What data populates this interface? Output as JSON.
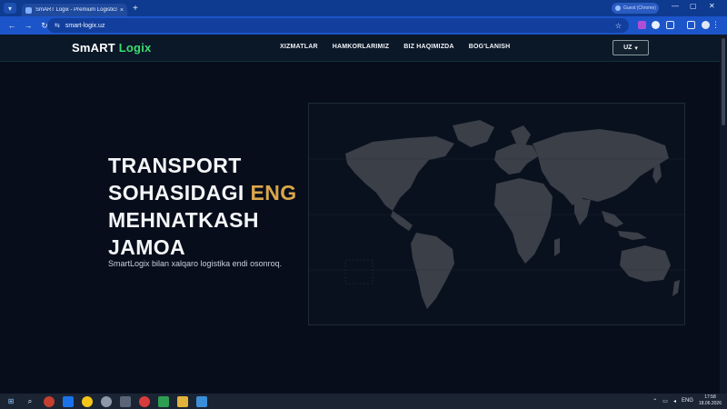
{
  "browser": {
    "tab_title": "SmART Logix - Premium Logistics",
    "tab_close": "×",
    "new_tab": "+",
    "profile": "Guest (Chrome)",
    "url": "smart-logix.uz",
    "back": "←",
    "forward": "→",
    "reload": "↻",
    "site_info": "⇆",
    "star": "☆",
    "menu": "⋮",
    "minimize": "—",
    "maximize": "▢",
    "close": "✕"
  },
  "header": {
    "logo_part1": "SmART",
    "logo_part2": "Logix",
    "nav": [
      "XIZMATLAR",
      "HAMKORLARIMIZ",
      "BIZ HAQIMIZDA",
      "BOG'LANISH"
    ],
    "lang": "UZ",
    "lang_caret": "▾"
  },
  "hero": {
    "title_line1": "TRANSPORT",
    "title_line2_a": "SOHASIDAGI ",
    "title_line2_b": "ENG",
    "title_line3": "MEHNATKASH",
    "title_line4": "JAMOA",
    "subtitle": "SmartLogix bilan xalqaro logistika endi osonroq."
  },
  "taskbar": {
    "lang": "ENG",
    "time": "17:58",
    "date": "18.06.2026"
  },
  "colors": {
    "accent_green": "#3ddc6e",
    "accent_gold": "#d9a64a",
    "page_bg": "#070d1b",
    "browser_blue": "#1c55c9"
  }
}
